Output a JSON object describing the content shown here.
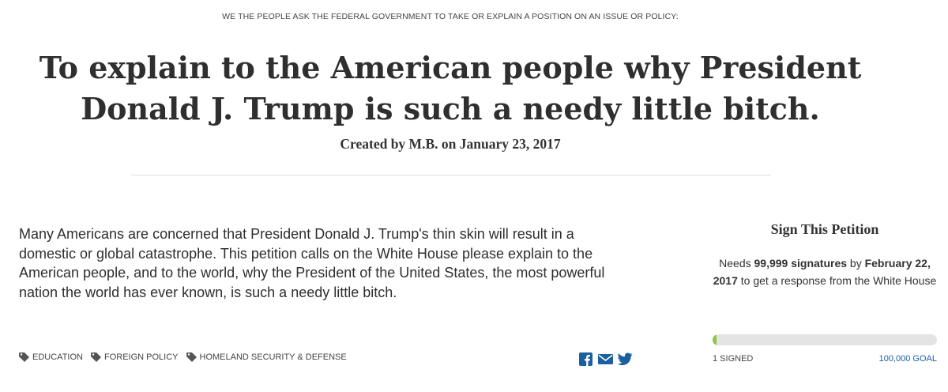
{
  "header": {
    "kicker": "WE THE PEOPLE ASK THE FEDERAL GOVERNMENT TO TAKE OR EXPLAIN A POSITION ON AN ISSUE OR POLICY:",
    "title": "To explain to the American people why President Donald J. Trump is such a needy little bitch.",
    "byline": "Created by M.B. on January 23, 2017"
  },
  "petition": {
    "body": "Many Americans are concerned that President Donald J. Trump's thin skin will result in a domestic or global catastrophe. This petition calls on the White House please explain to the American people, and to the world, why the President of the United States, the most powerful nation the world has ever known, is such a needy little bitch.",
    "tags": [
      {
        "label": "EDUCATION",
        "icon": "tag-icon"
      },
      {
        "label": "FOREIGN POLICY",
        "icon": "tag-icon"
      },
      {
        "label": "HOMELAND SECURITY & DEFENSE",
        "icon": "tag-icon"
      }
    ],
    "share": [
      {
        "icon": "facebook-icon"
      },
      {
        "icon": "email-icon"
      },
      {
        "icon": "twitter-icon"
      }
    ]
  },
  "sidebar": {
    "title": "Sign This Petition",
    "needs_prefix": "Needs ",
    "needs_count": "99,999 signatures",
    "needs_mid": " by ",
    "needs_date": "February 22, 2017",
    "needs_suffix": " to get a response from the White House",
    "signed_label": "1 SIGNED",
    "goal_label": "100,000 GOAL",
    "progress_fraction": 1e-05
  },
  "colors": {
    "accent": "#1a5f9e",
    "progress": "#8dc63f",
    "track": "#e4e4e4"
  }
}
